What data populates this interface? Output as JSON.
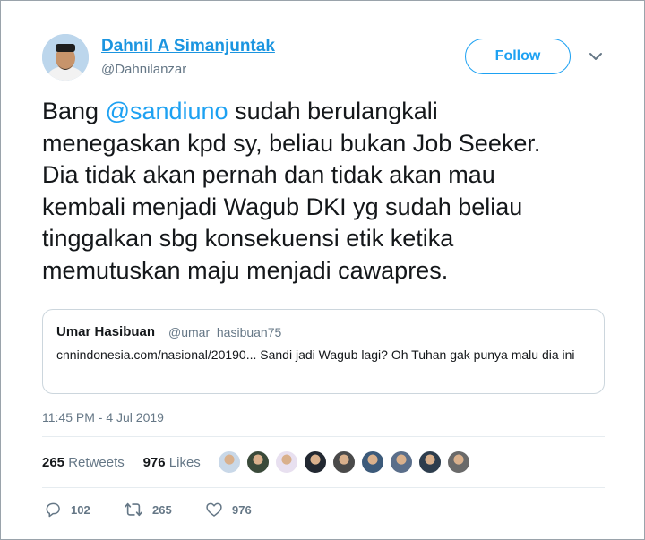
{
  "author": {
    "name": "Dahnil A Simanjuntak",
    "handle": "@Dahnilanzar"
  },
  "follow": {
    "label": "Follow"
  },
  "tweet": {
    "lines": [
      [
        "Bang ",
        "@sandiuno",
        " sudah berulangkali"
      ],
      "menegaskan kpd sy, beliau bukan Job Seeker.",
      "Dia tidak akan pernah dan tidak akan mau",
      "kembali menjadi Wagub DKI yg sudah beliau",
      "tinggalkan sbg konsekuensi etik ketika",
      "memutuskan maju menjadi cawapres."
    ]
  },
  "quote": {
    "name": "Umar Hasibuan",
    "handle": "@umar_hasibuan75",
    "text": "cnnindonesia.com/nasional/20190... Sandi jadi Wagub lagi? Oh Tuhan gak punya malu dia ini"
  },
  "timestamp": "11:45 PM - 4 Jul 2019",
  "stats": {
    "retweets_count": "265",
    "retweets_label": "Retweets",
    "likes_count": "976",
    "likes_label": "Likes"
  },
  "liker_colors": [
    "#c9d8e8",
    "#3a4a3a",
    "#e8e0f0",
    "#222831",
    "#4a4a4a",
    "#3c5a7a",
    "#5a6e8a",
    "#2d3d4d",
    "#6a6a6a"
  ],
  "actions": {
    "replies": "102",
    "retweets": "265",
    "likes": "976"
  },
  "icons": {
    "reply": "reply-icon",
    "retweet": "retweet-icon",
    "like": "heart-icon",
    "more": "chevron-down-icon"
  },
  "colors": {
    "link": "#1da1f2",
    "name": "#1b95e0",
    "muted": "#657786"
  }
}
